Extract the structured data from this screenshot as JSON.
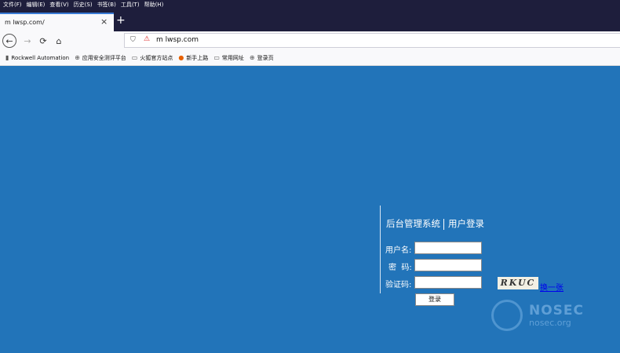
{
  "menubar": {
    "items": [
      "文件(F)",
      "编辑(E)",
      "查看(V)",
      "历史(S)",
      "书签(B)",
      "工具(T)",
      "帮助(H)"
    ]
  },
  "tab": {
    "title": "m        lwsp.com/",
    "close": "×",
    "new_tab": "+"
  },
  "nav": {
    "back": "←",
    "forward": "→",
    "reload": "⟳",
    "home": "⌂",
    "url": "m        lwsp.com",
    "shield": "⛉",
    "lock": "⚠"
  },
  "bookmarks": [
    {
      "icon": "▮",
      "label": "Rockwell Automation"
    },
    {
      "icon": "⊕",
      "label": "应用安全测评平台"
    },
    {
      "icon": "▭",
      "label": "火狐官方站点"
    },
    {
      "icon": "●",
      "label": "新手上路"
    },
    {
      "icon": "▭",
      "label": "常用网址"
    },
    {
      "icon": "⊕",
      "label": "登录页"
    }
  ],
  "login": {
    "system_title": "后台管理系统",
    "subtitle": "用户登录",
    "username_label": "用户名:",
    "password_label": "密  码:",
    "captcha_label": "验证码:",
    "captcha_text": "RKUC",
    "refresh_link": "换一张",
    "submit_label": "登录"
  },
  "watermark": {
    "title": "NOSEC",
    "subtitle": "nosec.org"
  }
}
